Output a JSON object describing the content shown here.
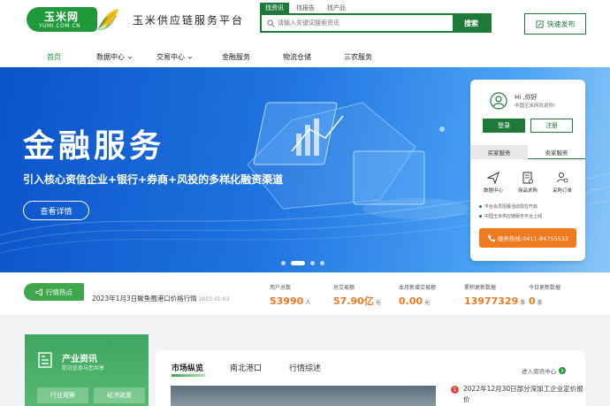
{
  "header": {
    "logo_main": "玉米网",
    "logo_sub": "YUMI.COM.CN",
    "platform_title": "玉米供应链服务平台",
    "search_tabs": [
      "找资讯",
      "找报告",
      "找产品"
    ],
    "search_placeholder": "请输入关键词搜索资讯",
    "search_button": "搜索",
    "publish_button": "快速发布"
  },
  "nav": {
    "items": [
      "首页",
      "数据中心",
      "交易中心",
      "金融服务",
      "物流仓储",
      "三农服务"
    ],
    "active_index": 0
  },
  "banner": {
    "title": "金融服务",
    "subtitle": "引入核心资信企业+银行+券商+风投的多样化融资渠道",
    "button": "查看详情",
    "slide_count": 4,
    "active_slide": 1
  },
  "login_card": {
    "greeting": "Hi ,你好",
    "welcome": "中国玉米网欢迎你!",
    "login_button": "登录",
    "register_button": "注册",
    "tabs": [
      "买家服务",
      "卖家服务"
    ],
    "services": [
      {
        "label": "数据中心",
        "icon": "send-icon"
      },
      {
        "label": "商品求购",
        "icon": "document-icon"
      },
      {
        "label": "采购订单",
        "icon": "user-order-icon"
      }
    ],
    "notices": [
      "平台会员招募活动现在开启",
      "中国玉米供应链服务平台上线"
    ],
    "hotline": "服务热线:0411-84755533"
  },
  "stats": {
    "hot_label": "行情热点",
    "hot_text": "2023年1月3日鲅鱼圈港口价格行情",
    "hot_date": "2023-01-03",
    "items": [
      {
        "label": "用户总数",
        "value": "53990",
        "unit": "人"
      },
      {
        "label": "总交易额",
        "value": "57.90亿",
        "unit": "元"
      },
      {
        "label": "本月新增交易额",
        "value": "0.00",
        "unit": "元"
      },
      {
        "label": "累积更新数据",
        "value": "13977329",
        "unit": "条"
      },
      {
        "label": "今日更新数据",
        "value": "0",
        "unit": "条"
      }
    ]
  },
  "industry": {
    "title": "产业资讯",
    "subtitle": "前沿信息与您共享",
    "buttons": [
      "行业观察",
      "经济政策"
    ]
  },
  "news": {
    "tabs": [
      "市场纵览",
      "南北港口",
      "行情综述"
    ],
    "more": "进入资讯中心",
    "items": [
      {
        "num": "1",
        "text": "2022年12月30日部分深加工企业定价报价"
      }
    ]
  },
  "colors": {
    "brand_green": "#1f7a3a",
    "accent_orange": "#f07a20"
  }
}
